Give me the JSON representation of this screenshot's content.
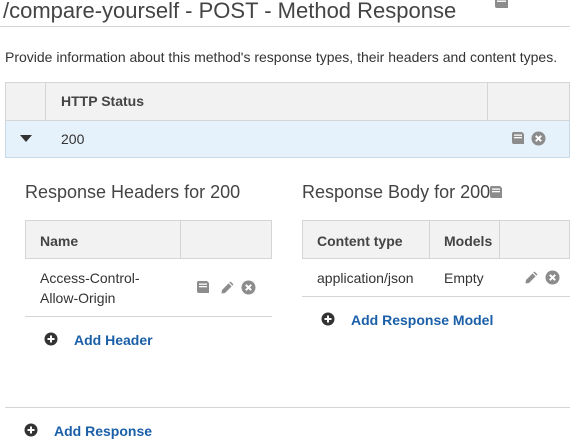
{
  "page": {
    "title": "/compare-yourself - POST - Method Response",
    "description": "Provide information about this method's response types, their headers and content types."
  },
  "status_table": {
    "header": "HTTP Status",
    "rows": [
      {
        "code": "200"
      }
    ]
  },
  "response_headers": {
    "title": "Response Headers for 200",
    "columns": {
      "name": "Name"
    },
    "rows": [
      {
        "name_line1": "Access-Control-",
        "name_line2": "Allow-Origin"
      }
    ],
    "add_label": "Add Header"
  },
  "response_body": {
    "title": "Response Body for 200",
    "columns": {
      "content_type": "Content type",
      "models": "Models"
    },
    "rows": [
      {
        "content_type": "application/json",
        "model": "Empty"
      }
    ],
    "add_label": "Add Response Model"
  },
  "footer": {
    "add_response_label": "Add Response"
  },
  "colors": {
    "link": "#1a5fa8",
    "icon": "#8c8c8c",
    "selected_row": "#e5f1fb",
    "header_bg": "#f2f2f2"
  },
  "icons": [
    "book-icon",
    "pencil-icon",
    "remove-icon",
    "plus-circle-icon",
    "caret-down-icon"
  ]
}
